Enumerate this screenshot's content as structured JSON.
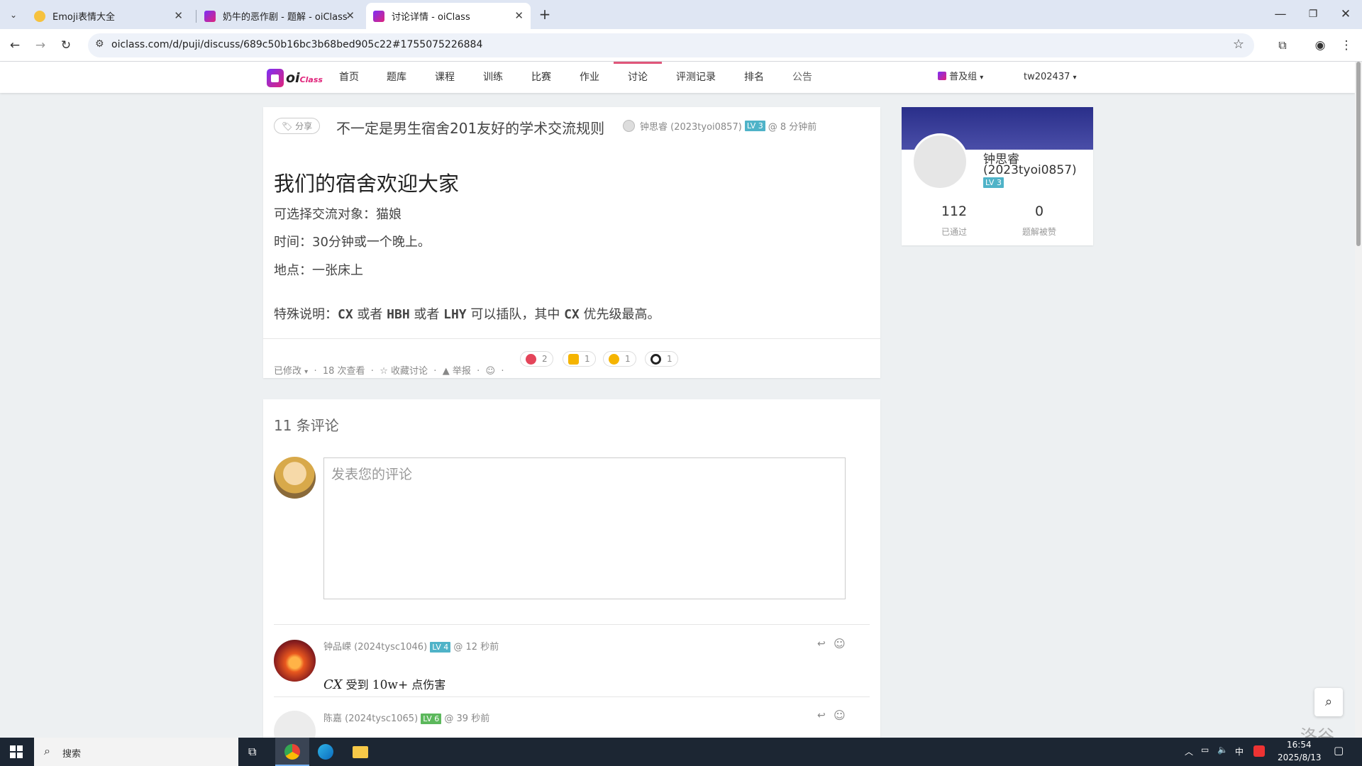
{
  "browser": {
    "tabs": [
      {
        "title": "Emoji表情大全"
      },
      {
        "title": "奶牛的恶作剧 - 题解 - oiClass"
      },
      {
        "title": "讨论详情 - oiClass"
      }
    ],
    "new_tab": "+",
    "url": "oiclass.com/d/puji/discuss/689c50b16bc3b68bed905c22#1755075226884"
  },
  "site": {
    "logo": "oi",
    "logo_sub": "Class",
    "nav": [
      "首页",
      "题库",
      "课程",
      "训练",
      "比赛",
      "作业",
      "讨论",
      "评测记录",
      "排名",
      "公告"
    ],
    "active_nav": "讨论",
    "domain_selector": "普及组",
    "user": "tw202437"
  },
  "discussion": {
    "tag": "分享",
    "title": "不一定是男生宿舍201友好的学术交流规则",
    "author": "钟思睿 (2023tyoi0857)",
    "level": "LV 3",
    "time": "@ 8 分钟前",
    "heading": "我们的宿舍欢迎大家",
    "lines": [
      "可选择交流对象：猫娘",
      "时间：30分钟或一个晚上。",
      "地点：一张床上"
    ],
    "special": {
      "prefix": "特殊说明：",
      "a": "CX",
      "mid1": " 或者 ",
      "b": "HBH",
      "mid2": " 或者 ",
      "c": "LHY",
      "mid3": " 可以插队，其中 ",
      "d": "CX",
      "suffix": " 优先级最高。"
    },
    "footer": {
      "edited": "已修改",
      "views": "18 次查看",
      "star": "收藏讨论",
      "report": "举报",
      "reactions": [
        {
          "icon": "laugh-emoji-icon",
          "count": "2",
          "color": "#e4455a"
        },
        {
          "icon": "thumbs-down-emoji-icon",
          "count": "1",
          "color": "#f5b400"
        },
        {
          "icon": "confused-emoji-icon",
          "count": "1",
          "color": "#f5b400"
        },
        {
          "icon": "eyes-emoji-icon",
          "count": "1",
          "color": "#ffffff"
        }
      ]
    }
  },
  "comments": {
    "count_label": "11 条评论",
    "placeholder": "发表您的评论",
    "items": [
      {
        "author": "钟品嵘 (2024tysc1046)",
        "level": "LV 4",
        "level_color": "#4fb3c8",
        "time": "@ 12 秒前",
        "body_math": "CX",
        "body_mid": " 受到 ",
        "body_math2": "10w+",
        "body_end": " 点伤害"
      },
      {
        "author": "陈嘉 (2024tysc1065)",
        "level": "LV 6",
        "level_color": "#5cb85c",
        "time": "@ 39 秒前"
      }
    ]
  },
  "profile": {
    "name": "钟思睿",
    "id": "(2023tyoi0857)",
    "level": "LV 3",
    "stats": [
      {
        "value": "112",
        "label": "已通过"
      },
      {
        "value": "0",
        "label": "题解被赞"
      }
    ]
  },
  "taskbar": {
    "search": "搜索",
    "ime": "中",
    "time": "16:54",
    "date": "2025/8/13"
  },
  "watermark": "洛谷",
  "colors": {
    "accent": "#e0567a",
    "level_lv3": "#4fb3c8",
    "banner": "#3a3f9a"
  }
}
